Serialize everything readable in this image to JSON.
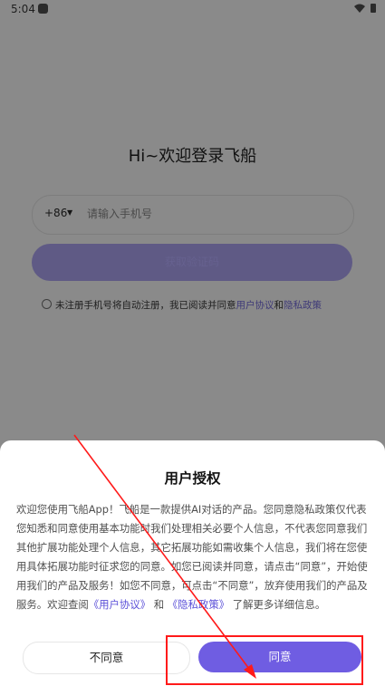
{
  "status_bar": {
    "time": "5:04"
  },
  "login": {
    "title": "Hi~欢迎登录飞船",
    "country_code": "+86",
    "phone_placeholder": "请输入手机号",
    "get_code_button": "获取验证码",
    "agreement_prefix": "未注册手机号将自动注册，我已阅读并同意",
    "user_agreement_link": "用户协议",
    "and": "和",
    "privacy_policy_link": "隐私政策"
  },
  "dialog": {
    "title": "用户授权",
    "body_part1": "欢迎您使用飞船App！飞船是一款提供AI对话的产品。您同意隐私政策仅代表您知悉和同意使用基本功能时我们处理相关必要个人信息，不代表您同意我们其他扩展功能处理个人信息，其它拓展功能如需收集个人信息，我们将在您使用具体拓展功能时征求您的同意。如您已阅读并同意，请点击“同意”，开始使用我们的产品及服务！如您不同意，可点击“不同意”，放弃使用我们的产品及服务。欢迎查阅",
    "user_agreement_link": "《用户协议》",
    "and": " 和 ",
    "privacy_policy_link": "《隐私政策》",
    "body_part2": " 了解更多详细信息。",
    "decline_button": "不同意",
    "accept_button": "同意"
  },
  "colors": {
    "accent": "#6f5de2",
    "annotation": "#ff1a1a"
  }
}
